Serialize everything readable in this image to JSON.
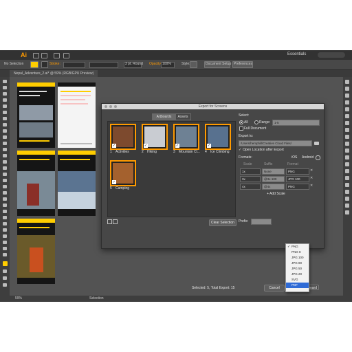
{
  "menubar": {
    "app_logo": "Ai",
    "workspace": "Essentials"
  },
  "controlbar": {
    "selection": "No Selection",
    "stroke_label": "Stroke:",
    "brush_value": "3 pt. Round",
    "opacity_label": "Opacity:",
    "opacity_value": "100%",
    "style_label": "Style:",
    "doc_setup": "Document Setup",
    "preferences": "Preferences"
  },
  "document_tab": "Nepal_Adventure_2.ai* @ 59% (RGB/GPU Preview)",
  "statusbar": {
    "zoom": "59%",
    "tool": "Selection"
  },
  "dialog": {
    "title": "Export for Screens",
    "tabs": [
      {
        "label": "Artboards",
        "active": true
      },
      {
        "label": "Assets",
        "active": false
      }
    ],
    "artboards": [
      {
        "num": "1",
        "name": "Activities",
        "color": "#7d4a2e"
      },
      {
        "num": "2",
        "name": "Hiking",
        "color": "#c9ccd2"
      },
      {
        "num": "3",
        "name": "Mountain Cl...",
        "color": "#6e8194"
      },
      {
        "num": "4",
        "name": "Ice Climbing",
        "color": "#58718f"
      },
      {
        "num": "5",
        "name": "Camping",
        "color": "#a4612e"
      }
    ],
    "clear_selection": "Clear Selection",
    "select": {
      "heading": "Select:",
      "all": "All",
      "range_label": "Range:",
      "range_value": "1-5",
      "full_document": "Full Document"
    },
    "export_to": {
      "heading": "Export to:",
      "path": "/Users/hemphill/Creative Cloud Files/",
      "open_after": "Open Location after Export"
    },
    "formats": {
      "heading": "Formats:",
      "ios": "iOS",
      "android": "Android",
      "col_scale": "Scale",
      "col_suffix": "Suffix",
      "col_format": "Format",
      "rows": [
        {
          "scale": "1x",
          "suffix": "None",
          "format": "PNG"
        },
        {
          "scale": "3x",
          "suffix": "@3x-100",
          "format": "JPG 100"
        },
        {
          "scale": "4x",
          "suffix": "@4x",
          "format": "PNG"
        }
      ],
      "add_scale": "+ Add Scale"
    },
    "prefix_label": "Prefix:",
    "footer": "Selected: 5, Total Export: 15",
    "cancel": "Cancel",
    "export": "Export Artboard"
  },
  "format_menu": {
    "options": [
      "PNG",
      "PNG 8",
      "JPG 100",
      "JPG 80",
      "JPG 50",
      "JPG 20",
      "SVG",
      "PDF"
    ],
    "checked": "PNG",
    "highlighted": "PDF"
  },
  "colors": {
    "accent": "#ff9a00",
    "highlight": "#2f6bd6",
    "dialog_bg": "#474747",
    "app_bg": "#535353"
  }
}
